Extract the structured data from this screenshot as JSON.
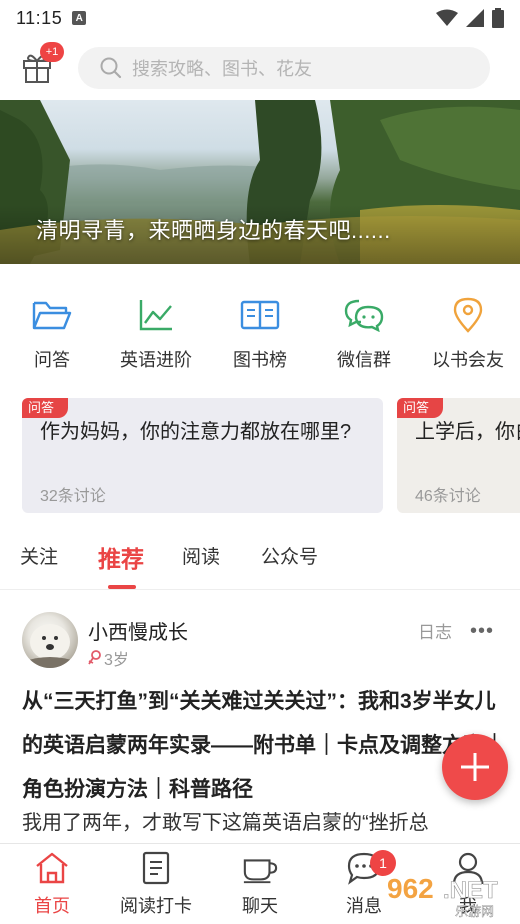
{
  "status_bar": {
    "time": "11:15",
    "notification_icon": "A"
  },
  "header": {
    "gift_badge": "+1",
    "search_placeholder": "搜索攻略、图书、花友"
  },
  "banner": {
    "title": "清明寻青，来晒晒身边的春天吧......"
  },
  "categories": [
    {
      "label": "问答",
      "icon": "folder-icon",
      "color": "#3b8ee0"
    },
    {
      "label": "英语进阶",
      "icon": "trend-chart-icon",
      "color": "#3aaa67"
    },
    {
      "label": "图书榜",
      "icon": "book-icon",
      "color": "#3b8ee0"
    },
    {
      "label": "微信群",
      "icon": "chat-bubbles-icon",
      "color": "#3aaa67"
    },
    {
      "label": "以书会友",
      "icon": "location-pin-icon",
      "color": "#f0a33c"
    }
  ],
  "question_cards": [
    {
      "tag": "问答",
      "question": "作为妈妈，你的注意力都放在哪里?",
      "count": "32条讨论"
    },
    {
      "tag": "问答",
      "question": "上学后，你白”时间?",
      "count": "46条讨论"
    }
  ],
  "tabs": [
    {
      "label": "关注",
      "active": false
    },
    {
      "label": "推荐",
      "active": true
    },
    {
      "label": "阅读",
      "active": false
    },
    {
      "label": "公众号",
      "active": false
    }
  ],
  "post": {
    "author": "小西慢成长",
    "age": "3岁",
    "type": "日志",
    "more": "•••",
    "title": "从“三天打鱼”到“关关难过关关过”：我和3岁半女儿的英语启蒙两年实录——附书单｜卡点及调整方案｜角色扮演方法｜科普路径",
    "body": "我用了两年，才敢写下这篇英语启蒙的“挫折总"
  },
  "bottom_nav": [
    {
      "label": "首页",
      "icon": "home-icon",
      "active": true
    },
    {
      "label": "阅读打卡",
      "icon": "checklist-icon",
      "active": false
    },
    {
      "label": "聊天",
      "icon": "cup-icon",
      "active": false
    },
    {
      "label": "消息",
      "icon": "message-icon",
      "active": false,
      "badge": "1"
    },
    {
      "label": "我",
      "icon": "user-icon",
      "active": false
    }
  ],
  "watermark": {
    "text": "962.NET",
    "sub": "乐游网"
  },
  "colors": {
    "accent": "#ea4545",
    "blue": "#3b8ee0",
    "green": "#3aaa67",
    "orange": "#f0a33c"
  }
}
